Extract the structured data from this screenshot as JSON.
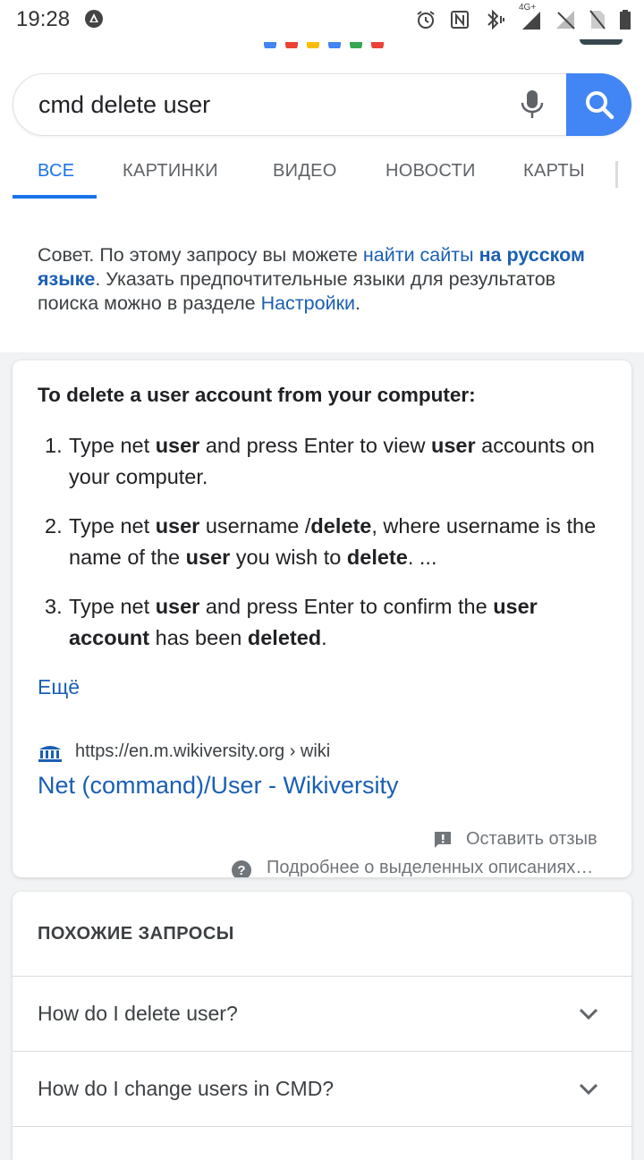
{
  "status_bar": {
    "time": "19:28",
    "network": "4G+"
  },
  "search": {
    "query": "cmd delete user"
  },
  "tabs": [
    {
      "label": "ВСЕ",
      "active": true
    },
    {
      "label": "КАРТИНКИ",
      "active": false
    },
    {
      "label": "ВИДЕО",
      "active": false
    },
    {
      "label": "НОВОСТИ",
      "active": false
    },
    {
      "label": "КАРТЫ",
      "active": false
    }
  ],
  "tip": {
    "prefix": "Совет. По этому запросу вы можете ",
    "link_text": "найти сайты",
    "link_bold": "на русском языке",
    "middle": ". Указать предпочтительные языки для результатов поиска можно в разделе ",
    "settings_link": "Настройки",
    "suffix": "."
  },
  "featured": {
    "title": "To delete a user account from your computer:",
    "steps": [
      {
        "num": "1.",
        "parts": [
          "Type net ",
          "user",
          " and press Enter to view ",
          "user",
          " accounts on your computer."
        ]
      },
      {
        "num": "2.",
        "parts": [
          "Type net ",
          "user",
          " username /",
          "delete",
          ", where username is the name of the ",
          "user",
          " you wish to ",
          "delete",
          ". ..."
        ]
      },
      {
        "num": "3.",
        "parts": [
          "Type net ",
          "user",
          " and press Enter to confirm the ",
          "user account",
          " has been ",
          "deleted",
          "."
        ]
      }
    ],
    "more_label": "Ещё",
    "source_url": "https://en.m.wikiversity.org › wiki",
    "source_title": "Net (command)/User - Wikiversity",
    "feedback_label": "Оставить отзыв",
    "help_label": "Подробнее о выделенных описаниях…"
  },
  "related": {
    "title": "ПОХОЖИЕ ЗАПРОСЫ",
    "items": [
      "How do I delete user?",
      "How do I change users in CMD?"
    ]
  },
  "colors": {
    "accent": "#1a73e8",
    "search_button": "#4285f4",
    "link": "#1a5fb4"
  }
}
